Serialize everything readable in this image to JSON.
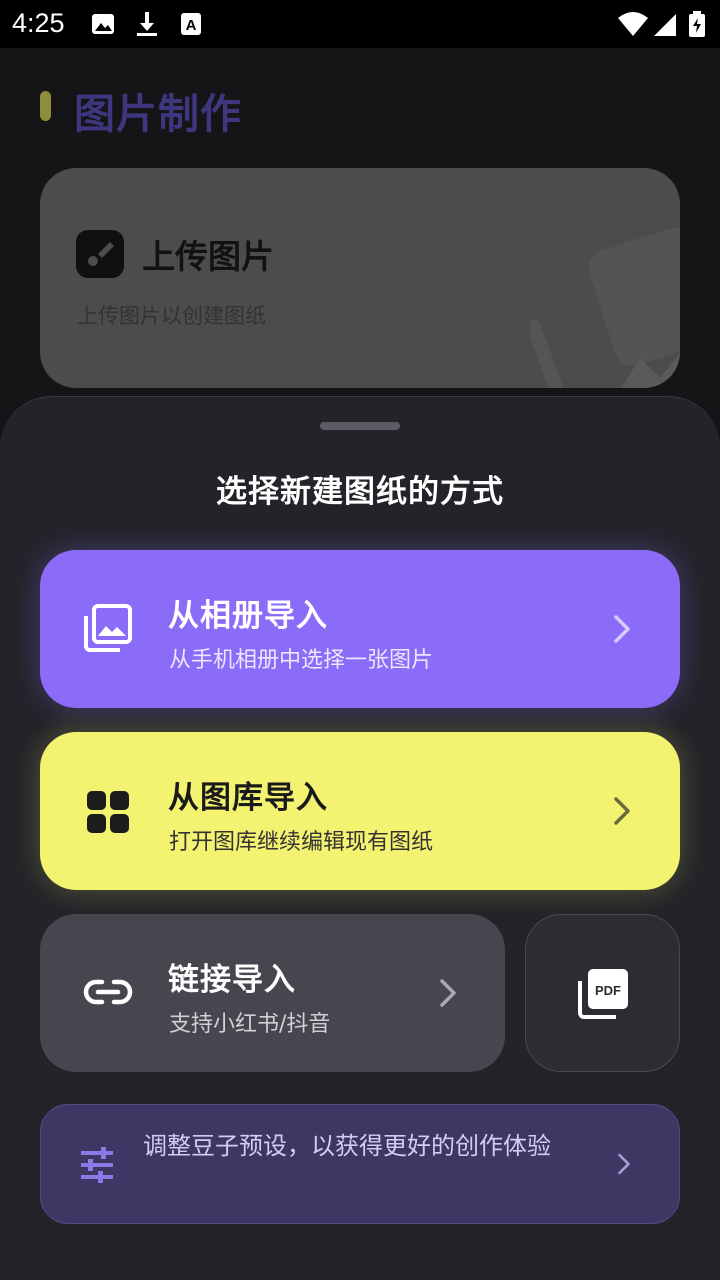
{
  "status_bar": {
    "time": "4:25",
    "icons": [
      "image-icon",
      "download-icon",
      "a-icon",
      "wifi-icon",
      "cellular-icon",
      "battery-icon"
    ]
  },
  "section": {
    "title": "图片制作"
  },
  "upload_card": {
    "title": "上传图片",
    "subtitle": "上传图片以创建图纸",
    "icon": "brush-icon"
  },
  "sheet": {
    "title": "选择新建图纸的方式",
    "options": {
      "album": {
        "title": "从相册导入",
        "subtitle": "从手机相册中选择一张图片",
        "icon": "photo-library-icon",
        "color": "#8b6cf8"
      },
      "library": {
        "title": "从图库导入",
        "subtitle": "打开图库继续编辑现有图纸",
        "icon": "grid-icon",
        "color": "#f3f271"
      },
      "link": {
        "title": "链接导入",
        "subtitle": "支持小红书/抖音",
        "icon": "link-icon"
      },
      "pdf": {
        "icon": "pdf-icon",
        "icon_text": "PDF"
      },
      "tune": {
        "text": "调整豆子预设，以获得更好的创作体验",
        "icon": "tune-icon"
      }
    }
  }
}
